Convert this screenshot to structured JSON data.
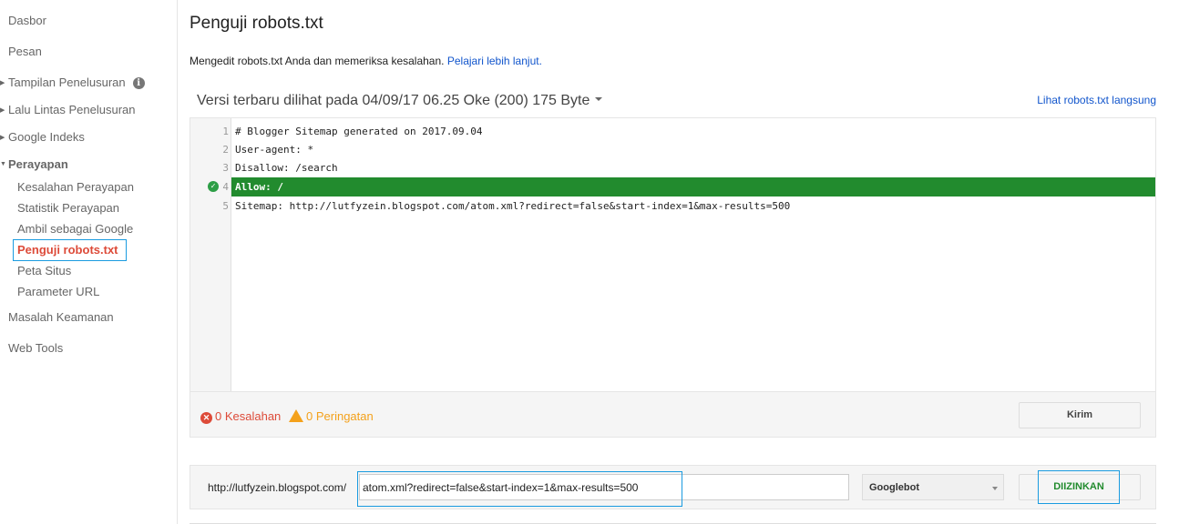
{
  "sidebar": {
    "items": [
      {
        "label": "Dasbor"
      },
      {
        "label": "Pesan"
      },
      {
        "label": "Tampilan Penelusuran"
      },
      {
        "label": "Lalu Lintas Penelusuran"
      },
      {
        "label": "Google Indeks"
      },
      {
        "label": "Perayapan"
      },
      {
        "label": "Kesalahan Perayapan"
      },
      {
        "label": "Statistik Perayapan"
      },
      {
        "label": "Ambil sebagai Google"
      },
      {
        "label": "Penguji robots.txt"
      },
      {
        "label": "Peta Situs"
      },
      {
        "label": "Parameter URL"
      },
      {
        "label": "Masalah Keamanan"
      },
      {
        "label": "Web Tools"
      }
    ],
    "info_icon": "i"
  },
  "page": {
    "title": "Penguji robots.txt",
    "description": "Mengedit robots.txt Anda dan memeriksa kesalahan.",
    "learn_more": "Pelajari lebih lanjut.",
    "version": "Versi terbaru dilihat pada 04/09/17 06.25 Oke (200) 175 Byte",
    "live_link": "Lihat robots.txt langsung"
  },
  "editor": {
    "lines": [
      {
        "n": "1",
        "code": "# Blogger Sitemap generated on 2017.09.04"
      },
      {
        "n": "2",
        "code": "User-agent: *"
      },
      {
        "n": "3",
        "code": "Disallow: /search"
      },
      {
        "n": "4",
        "code": "Allow: /"
      },
      {
        "n": "5",
        "code": "Sitemap: http://lutfyzein.blogspot.com/atom.xml?redirect=false&start-index=1&max-results=500"
      }
    ],
    "highlighted_line": 4,
    "errors": "0 Kesalahan",
    "warnings": "0 Peringatan",
    "submit": "Kirim"
  },
  "test": {
    "prefix": "http://lutfyzein.blogspot.com/",
    "url": "atom.xml?redirect=false&start-index=1&max-results=500",
    "agent": "Googlebot",
    "result": "DIIZINKAN"
  },
  "colors": {
    "allow": "#228b2e",
    "error": "#dd4b39",
    "warning": "#f4a11b",
    "link": "#1155cc"
  }
}
